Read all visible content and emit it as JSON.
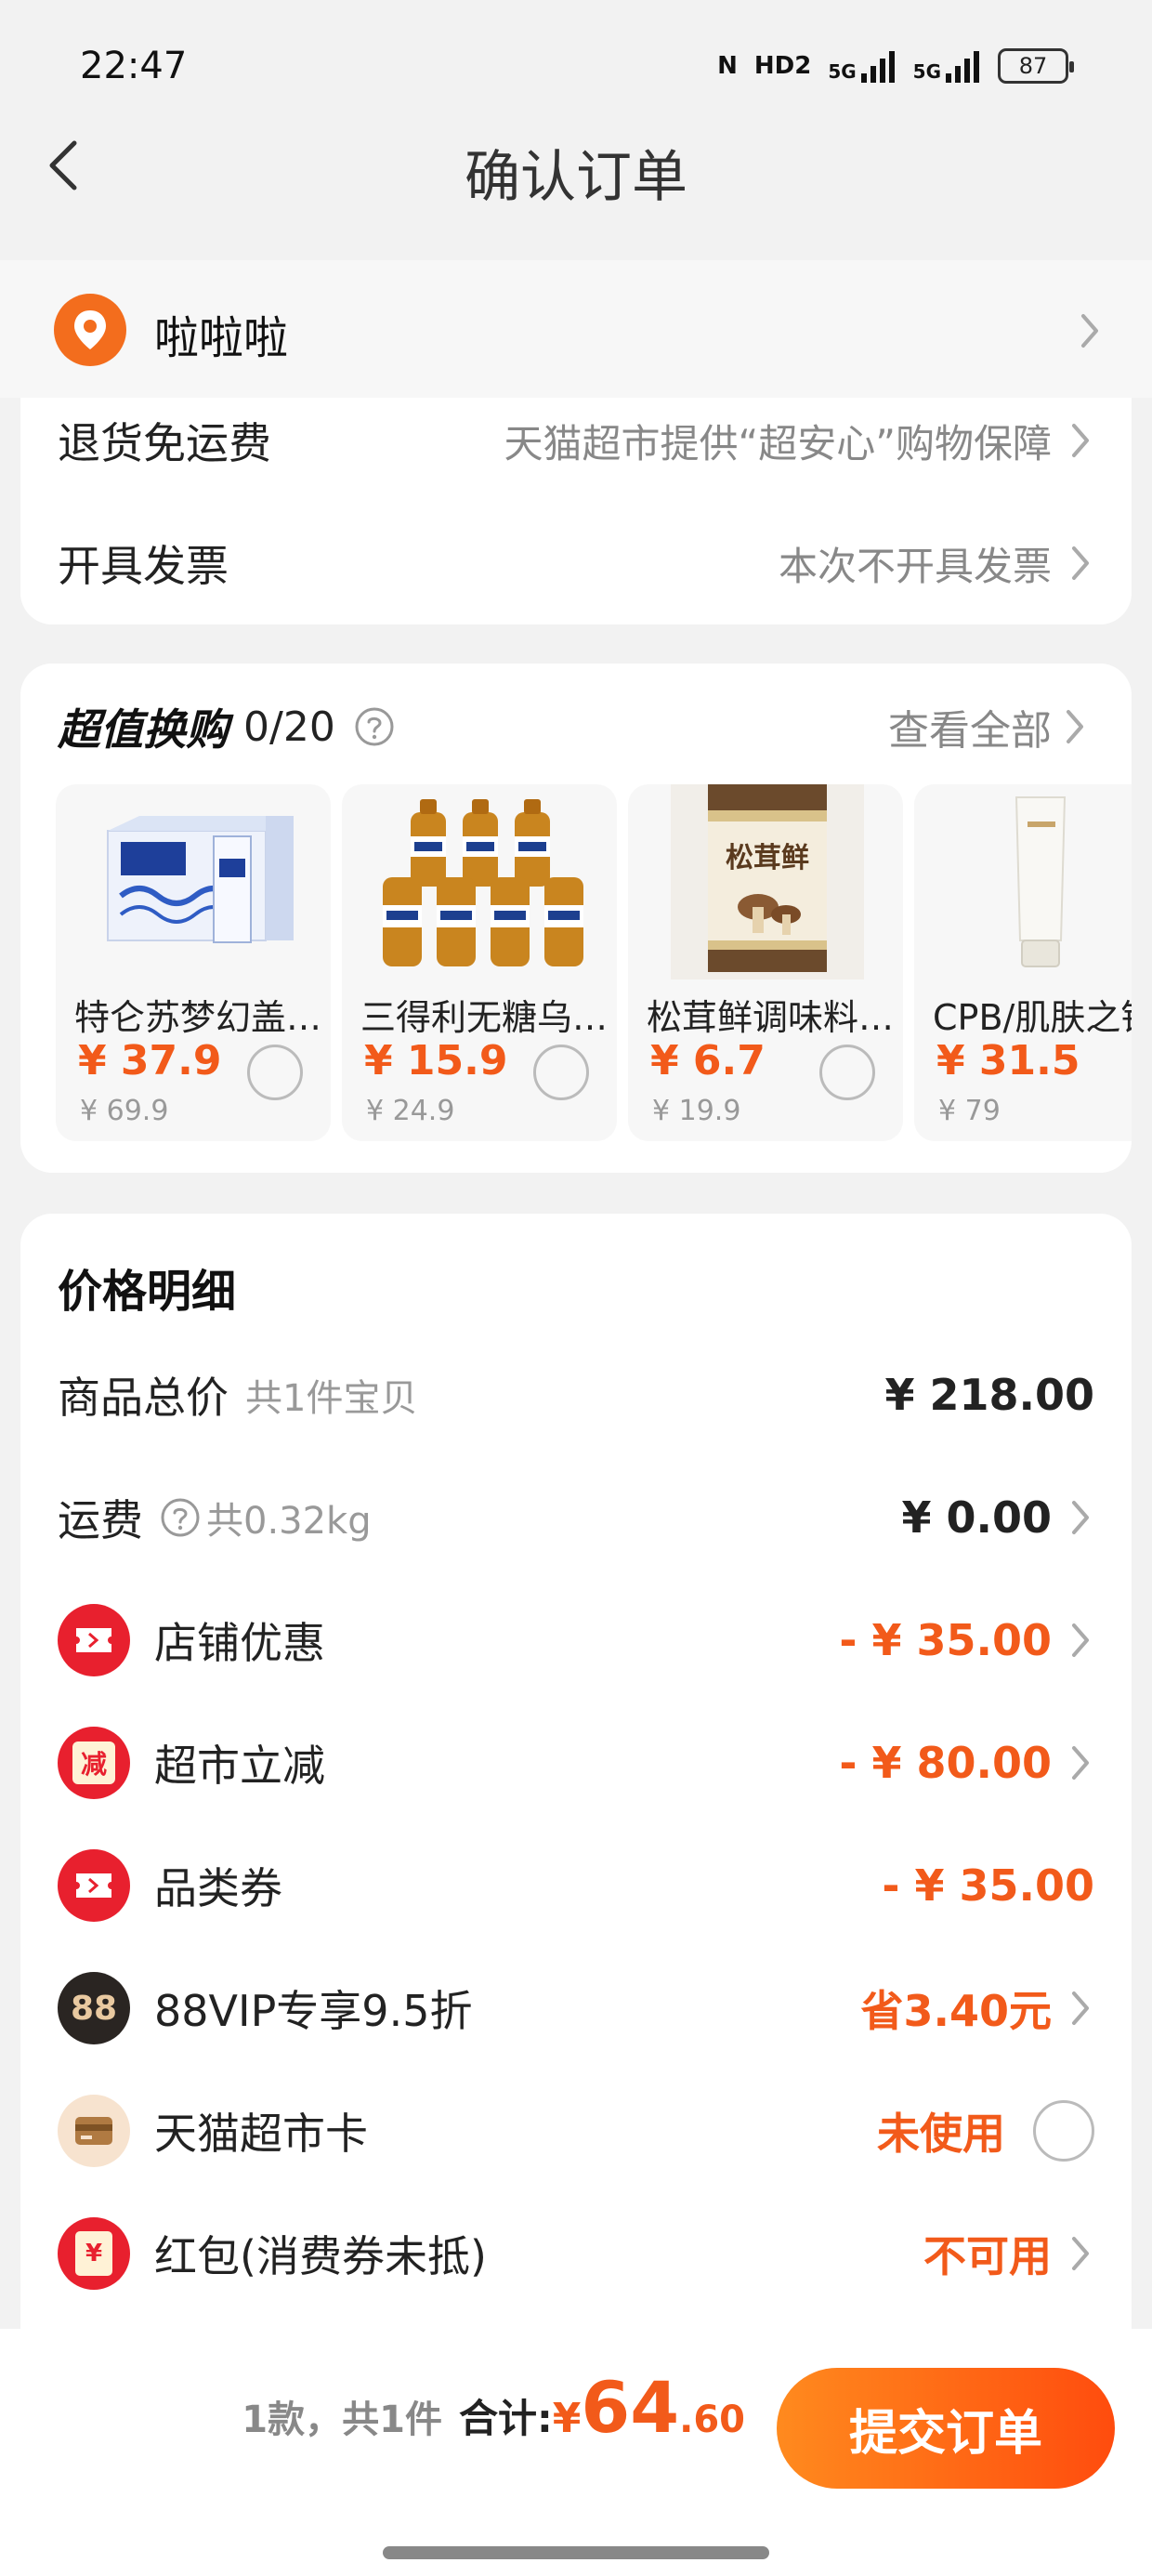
{
  "status": {
    "time": "22:47",
    "nfc": "N",
    "hd": "HD2",
    "signal1": "5G",
    "signal2": "5G",
    "battery": "87"
  },
  "nav": {
    "title": "确认订单"
  },
  "address": {
    "name": "啦啦啦"
  },
  "info": {
    "return_label": "退货免运费",
    "return_value": "天猫超市提供“超安心”购物保障",
    "invoice_label": "开具发票",
    "invoice_value": "本次不开具发票"
  },
  "swap": {
    "title": "超值换购",
    "count": "0/20",
    "view_all": "查看全部",
    "products": [
      {
        "name": "特仑苏梦幻盖…",
        "price": "¥ 37.9",
        "old_price": "¥ 69.9",
        "image": "milk-box"
      },
      {
        "name": "三得利无糖乌…",
        "price": "¥ 15.9",
        "old_price": "¥ 24.9",
        "image": "oolong-bottles"
      },
      {
        "name": "松茸鲜调味料…",
        "price": "¥ 6.7",
        "old_price": "¥ 19.9",
        "image": "mushroom-jar",
        "jar_label": "松茸鲜"
      },
      {
        "name": "CPB/肌肤之钥",
        "price": "¥ 31.5",
        "old_price": "¥ 79",
        "image": "cleanser-tube"
      }
    ]
  },
  "price": {
    "title": "价格明细",
    "rows": [
      {
        "label": "商品总价",
        "sub": "共1件宝贝",
        "value": "¥ 218.00"
      },
      {
        "label": "运费",
        "sub": "共0.32kg",
        "value": "¥ 0.00"
      },
      {
        "label": "店铺优惠",
        "value": "- ¥ 35.00"
      },
      {
        "label": "超市立减",
        "value": "- ¥ 80.00",
        "icon_text": "减"
      },
      {
        "label": "品类券",
        "value": "- ¥ 35.00"
      },
      {
        "label": "88VIP专享9.5折",
        "value": "省3.40元",
        "icon_text": "88"
      },
      {
        "label": "天猫超市卡",
        "value": "未使用"
      },
      {
        "label": "红包(消费券未抵)",
        "value": "不可用",
        "icon_text": "¥"
      }
    ]
  },
  "bottom": {
    "count": "1款，共1件",
    "total_label": "合计:",
    "yen": "¥",
    "total_int": "64",
    "total_dec": ".60",
    "submit": "提交订单"
  },
  "colors": {
    "accent": "#f25a1a",
    "pin": "#f36d1d",
    "red_icon": "#e8202e"
  }
}
